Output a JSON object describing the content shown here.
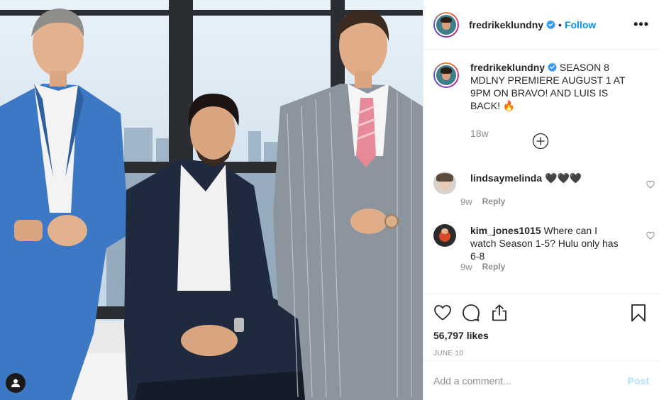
{
  "post": {
    "username": "fredrikeklundny",
    "follow_label": "Follow",
    "separator": "•",
    "more_label": "•••",
    "caption": "SEASON 8 MDLNY PREMIERE AUGUST 1 AT 9PM ON BRAVO! AND LUIS IS BACK! 🔥",
    "caption_time": "18w",
    "likes": "56,797 likes",
    "date": "JUNE 10"
  },
  "comments": [
    {
      "username": "lindsaymelinda",
      "text": "🖤🖤🖤",
      "time": "9w",
      "reply_label": "Reply"
    },
    {
      "username": "kim_jones1015",
      "text": "Where can I watch Season 1-5? Hulu only has 6-8",
      "time": "9w",
      "reply_label": "Reply"
    }
  ],
  "composer": {
    "placeholder": "Add a comment...",
    "post_label": "Post"
  },
  "icons": {
    "verified": "verified-badge-icon",
    "more": "more-options-icon",
    "load_more": "plus-circle-icon",
    "like": "heart-icon",
    "comment": "comment-bubble-icon",
    "share": "share-icon",
    "save": "bookmark-icon",
    "user_tag": "user-tag-icon"
  },
  "colors": {
    "accent": "#0095f6",
    "post_disabled": "#b2dffc",
    "muted": "#8e8e8e",
    "border": "#efefef"
  }
}
